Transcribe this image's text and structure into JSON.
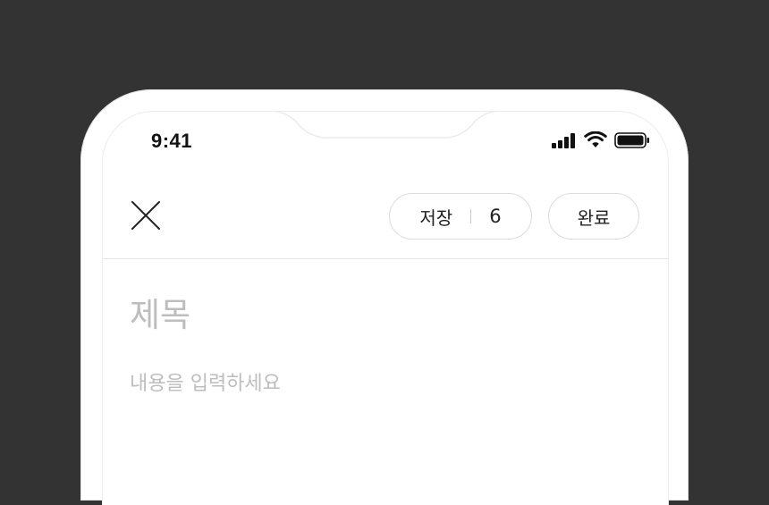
{
  "status_bar": {
    "time": "9:41",
    "icons": [
      "signal-icon",
      "wifi-icon",
      "battery-icon"
    ]
  },
  "toolbar": {
    "close_icon": "close-icon",
    "save_label": "저장",
    "save_count": "6",
    "done_label": "완료"
  },
  "editor": {
    "title_placeholder": "제목",
    "body_placeholder": "내용을 입력하세요"
  },
  "colors": {
    "background": "#333333",
    "surface": "#ffffff",
    "placeholder": "#bdbdbd",
    "text": "#222222",
    "border": "#dcdcdc"
  }
}
